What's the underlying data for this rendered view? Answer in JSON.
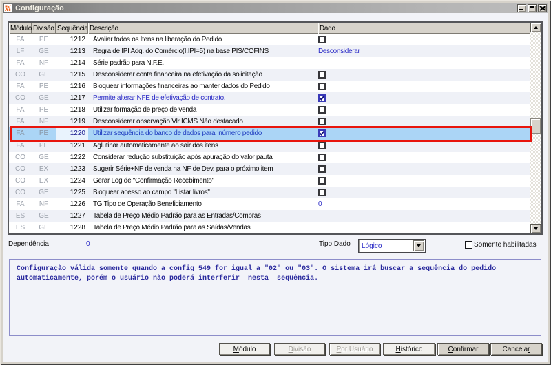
{
  "window": {
    "title": "Configuração",
    "icon": "app-logo-icon",
    "controls": [
      {
        "name": "minimize",
        "icon": "minimize-icon"
      },
      {
        "name": "maximize",
        "icon": "maximize-icon"
      },
      {
        "name": "close",
        "icon": "close-icon"
      }
    ]
  },
  "colors": {
    "titlebar_gradient_left": "#6a6a6a",
    "titlebar_gradient_right": "#bdbdbd",
    "client_bg": "#f2f3f8",
    "row_bg": "#ffffff",
    "row_alt_bg": "#eff1f7",
    "selected_row_bg": "#abd5f6",
    "selected_cell_bg": "#e9f3fd",
    "highlight_border_red": "#e8150d",
    "blue_text": "#2a2ac6",
    "muted_gray_text": "#9ba1ab",
    "header_face": "#d7d3cb"
  },
  "table": {
    "columns": [
      {
        "label": "Módulo"
      },
      {
        "label": "Divisão"
      },
      {
        "label": "Sequência"
      },
      {
        "label": "Descrição"
      },
      {
        "label": "Dado"
      }
    ],
    "rows": [
      {
        "modulo": "FA",
        "divisao": "PE",
        "sequencia": "1212",
        "descricao": "Avaliar todos os Itens na liberação do Pedido",
        "dado": "checkbox-unchecked"
      },
      {
        "modulo": "LF",
        "divisao": "GE",
        "sequencia": "1213",
        "descricao": "Regra de IPI Adq. do Comércio(I.IPI=5) na base PIS/COFINS",
        "dado": "Desconsiderar"
      },
      {
        "modulo": "FA",
        "divisao": "NF",
        "sequencia": "1214",
        "descricao": "Série padrão para N.F.E.",
        "dado": ""
      },
      {
        "modulo": "CO",
        "divisao": "GE",
        "sequencia": "1215",
        "descricao": "Desconsiderar conta financeira na efetivação da solicitação",
        "dado": "checkbox-unchecked"
      },
      {
        "modulo": "FA",
        "divisao": "PE",
        "sequencia": "1216",
        "descricao": "Bloquear informações financeiras ao manter dados do Pedido",
        "dado": "checkbox-unchecked"
      },
      {
        "modulo": "CO",
        "divisao": "GE",
        "sequencia": "1217",
        "descricao": "Permite alterar NFE de efetivação de contrato.",
        "dado": "checkbox-checked",
        "desc_blue": true
      },
      {
        "modulo": "FA",
        "divisao": "PE",
        "sequencia": "1218",
        "descricao": "Utilizar formação de preço de venda",
        "dado": "checkbox-unchecked"
      },
      {
        "modulo": "FA",
        "divisao": "NF",
        "sequencia": "1219",
        "descricao": "Desconsiderar observação Vlr ICMS Não destacado",
        "dado": "checkbox-unchecked"
      },
      {
        "modulo": "FA",
        "divisao": "PE",
        "sequencia": "1220",
        "descricao": "Utilizar sequência do banco de dados para  número pedido",
        "dado": "checkbox-checked",
        "desc_blue": true,
        "selected": true,
        "highlighted_red": true
      },
      {
        "modulo": "FA",
        "divisao": "PE",
        "sequencia": "1221",
        "descricao": "Aglutinar automaticamente ao sair dos itens",
        "dado": "checkbox-unchecked"
      },
      {
        "modulo": "CO",
        "divisao": "GE",
        "sequencia": "1222",
        "descricao": "Considerar redução substituição após apuração do valor pauta",
        "dado": "checkbox-unchecked"
      },
      {
        "modulo": "CO",
        "divisao": "EX",
        "sequencia": "1223",
        "descricao": "Sugerir Série+NF de venda na NF de Dev. para o próximo item",
        "dado": "checkbox-unchecked"
      },
      {
        "modulo": "CO",
        "divisao": "EX",
        "sequencia": "1224",
        "descricao": "Gerar Log de \"Confirmação Recebimento\"",
        "dado": "checkbox-unchecked"
      },
      {
        "modulo": "CO",
        "divisao": "GE",
        "sequencia": "1225",
        "descricao": "Bloquear acesso ao campo \"Listar livros\"",
        "dado": "checkbox-unchecked"
      },
      {
        "modulo": "FA",
        "divisao": "NF",
        "sequencia": "1226",
        "descricao": "TG Tipo de Operação Beneficiamento",
        "dado": "0"
      },
      {
        "modulo": "ES",
        "divisao": "GE",
        "sequencia": "1227",
        "descricao": "Tabela de Preço Médio Padrão para as Entradas/Compras",
        "dado": ""
      },
      {
        "modulo": "ES",
        "divisao": "GE",
        "sequencia": "1228",
        "descricao": "Tabela de Preço Médio Padrão para as Saídas/Vendas",
        "dado": ""
      }
    ]
  },
  "footer": {
    "dependencia_label": "Dependência",
    "dependencia_value": "0",
    "tipo_dado_label": "Tipo Dado",
    "tipo_dado_value": "Lógico",
    "somente_habilitadas_label": "Somente habilitadas",
    "somente_habilitadas_checked": false
  },
  "description_box": {
    "lines": [
      "Configuração válida somente quando a config 549 for igual a \"02\" ou \"03\". O sistema irá buscar a sequência do pedido",
      "automaticamente, porém o usuário não poderá interferir  nesta  sequência."
    ]
  },
  "buttons": [
    {
      "label": "Módulo",
      "accel": "M",
      "enabled": true,
      "emphasis": false
    },
    {
      "label": "Divisão",
      "accel": "D",
      "enabled": false,
      "emphasis": false
    },
    {
      "label": "Por Usuário",
      "accel": "P",
      "enabled": false,
      "emphasis": false
    },
    {
      "label": "Histórico",
      "accel": "H",
      "enabled": true,
      "emphasis": false
    },
    {
      "label": "Confirmar",
      "accel": "C",
      "enabled": true,
      "emphasis": true
    },
    {
      "label": "Cancelar",
      "accel": "r",
      "enabled": true,
      "emphasis": true
    }
  ]
}
